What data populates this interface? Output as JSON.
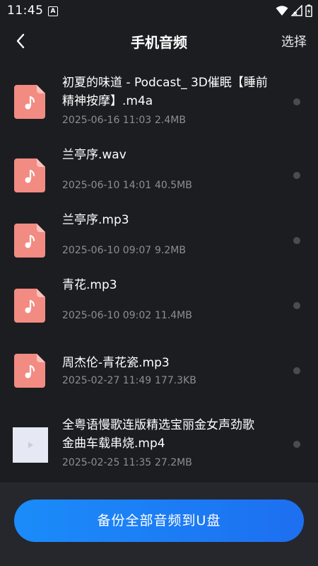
{
  "status_bar": {
    "time": "11:45",
    "notification_badge": "A",
    "icons": [
      "wifi-icon",
      "signal-icon",
      "battery-icon"
    ]
  },
  "header": {
    "title": "手机音频",
    "back_icon": "chevron-left-icon",
    "select_label": "选择"
  },
  "files": [
    {
      "name_line1": "初夏的味道 - Podcast_ 3D催眠【睡前",
      "name_line2": "精神按摩】.m4a",
      "date": "2025-06-16 11:03",
      "size": "2.4MB",
      "icon": "music-file-icon"
    },
    {
      "name_line1": "兰亭序.wav",
      "date": "2025-06-10 14:01",
      "size": "40.5MB",
      "icon": "music-file-icon"
    },
    {
      "name_line1": "兰亭序.mp3",
      "date": "2025-06-10 09:07",
      "size": "9.2MB",
      "icon": "music-file-icon"
    },
    {
      "name_line1": "青花.mp3",
      "date": "2025-06-10 09:02",
      "size": "11.4MB",
      "icon": "music-file-icon"
    },
    {
      "name_line1": "周杰伦-青花瓷.mp3",
      "date": "2025-02-27 11:49",
      "size": "177.3KB",
      "icon": "music-file-icon"
    },
    {
      "name_line1": "全粤语慢歌连版精选宝丽金女声劲歌",
      "name_line2": "金曲车载串烧.mp4",
      "date": "2025-02-25 11:35",
      "size": "27.2MB",
      "icon": "video-thumbnail-icon"
    }
  ],
  "bottom": {
    "backup_label": "备份全部音频到U盘"
  },
  "colors": {
    "background": "#1c1d21",
    "file_icon": "#f28b82",
    "accent": "#1b8cfa",
    "meta_text": "#8c8e95"
  }
}
